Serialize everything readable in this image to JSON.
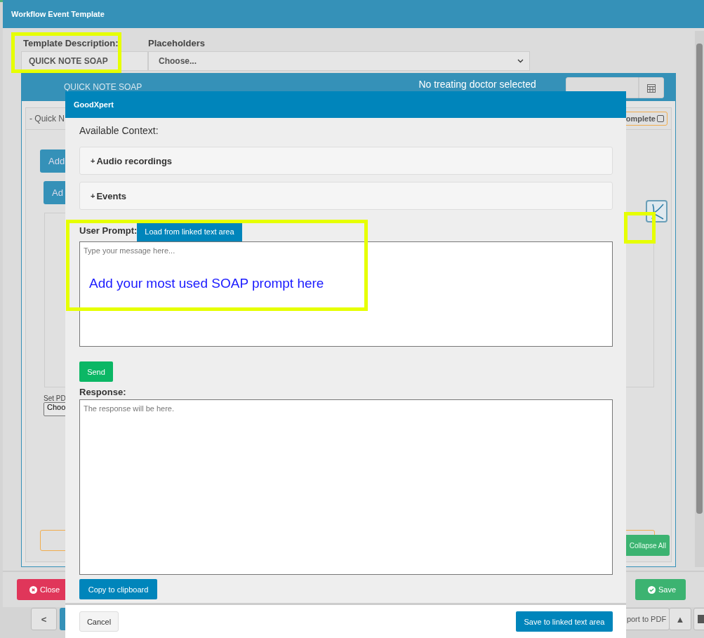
{
  "workflow_dialog": {
    "title": "Workflow Event Template",
    "template_description": {
      "label": "Template Description:",
      "value": "QUICK NOTE SOAP"
    },
    "placeholders": {
      "label": "Placeholders",
      "value": "Choose..."
    },
    "footer_buttons": [
      {
        "kind": "close",
        "label": "Close"
      },
      {
        "kind": "save",
        "label": "Save"
      }
    ]
  },
  "event_panel": {
    "title": "QUICK NOTE SOAP",
    "doctor_status": "No treating doctor selected",
    "section_title": "- Quick N",
    "complete": {
      "label": "omplete",
      "checked": false
    },
    "add_buttons": [
      "Add",
      "Ad"
    ],
    "pdf_label": "Set PD",
    "file_button": "Choo",
    "collapse_button": "Collapse All"
  },
  "background_bar": {
    "buttons": [
      {
        "kind": "icon",
        "label": "<"
      },
      {
        "kind": "text",
        "label": "port to PDF"
      },
      {
        "kind": "icon",
        "label": "▲"
      }
    ]
  },
  "goodxpert_dialog": {
    "title": "GoodXpert",
    "context_label": "Available Context:",
    "context_sections": [
      {
        "marker": "+",
        "label": "Audio recordings",
        "expanded": false
      },
      {
        "marker": "+",
        "label": "Events",
        "expanded": false
      }
    ],
    "prompt_label": "User Prompt:",
    "load_button": "Load from linked text area",
    "prompt_placeholder": "Type your message here...",
    "send_button": "Send",
    "response_label": "Response:",
    "response_placeholder": "The response will be here.",
    "copy_button": "Copy to clipboard",
    "cancel_button": "Cancel",
    "save_linked_button": "Save to linked text area"
  },
  "annotations": {
    "prompt_note": "Add your most used SOAP prompt here"
  }
}
